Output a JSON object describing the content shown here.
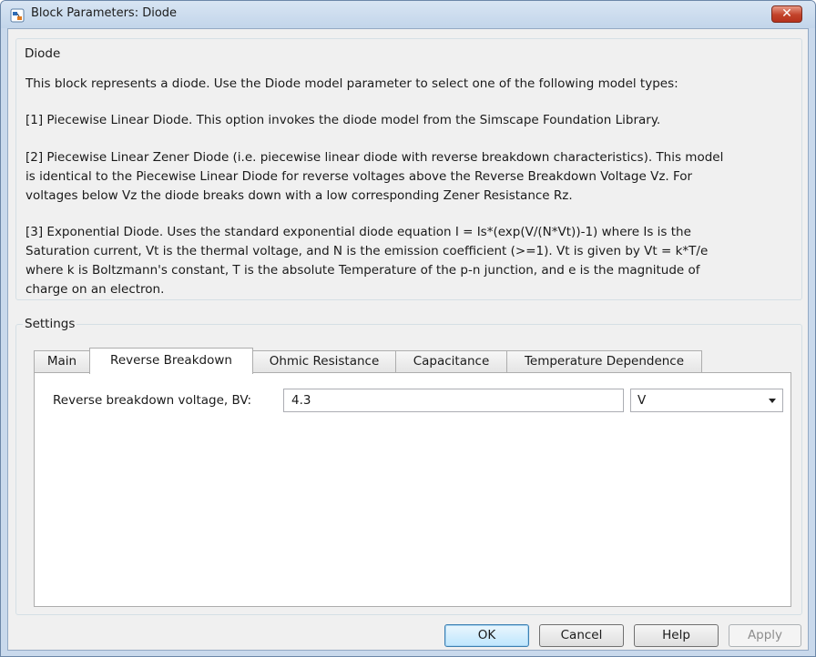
{
  "window": {
    "title": "Block Parameters: Diode",
    "close_label": "✕"
  },
  "description": {
    "group_label": "Diode",
    "line_intro": "This block represents a diode. Use the Diode model parameter to select one of the following model types:",
    "line_1": "[1] Piecewise Linear Diode. This option invokes the diode model from the Simscape Foundation Library.",
    "line_2a": "[2] Piecewise Linear Zener Diode (i.e. piecewise linear diode with reverse breakdown characteristics). This model",
    "line_2b": "is identical to the Piecewise Linear Diode for reverse voltages above the Reverse Breakdown Voltage Vz. For",
    "line_2c": "voltages below Vz the diode breaks down with a low corresponding Zener Resistance Rz.",
    "line_3a": "[3] Exponential Diode. Uses the standard exponential diode equation I = Is*(exp(V/(N*Vt))-1) where Is is the",
    "line_3b": "Saturation current, Vt is the thermal voltage, and N is the emission coefficient (>=1). Vt is given by Vt = k*T/e",
    "line_3c": "where k is Boltzmann's constant, T is the absolute Temperature of the p-n junction, and e is the magnitude of",
    "line_3d": "charge on an electron."
  },
  "settings": {
    "group_label": "Settings",
    "tabs": [
      {
        "label": "Main"
      },
      {
        "label": "Reverse Breakdown"
      },
      {
        "label": "Ohmic Resistance"
      },
      {
        "label": "Capacitance"
      },
      {
        "label": "Temperature Dependence"
      }
    ],
    "active_tab": "Reverse Breakdown",
    "field": {
      "label": "Reverse breakdown voltage, BV:",
      "value": "4.3",
      "unit": "V"
    }
  },
  "buttons": {
    "ok": "OK",
    "cancel": "Cancel",
    "help": "Help",
    "apply": "Apply"
  },
  "colors": {
    "window_frame": "#c9d9ec",
    "close_button": "#c2422a",
    "default_button_border": "#3c7fb1"
  }
}
